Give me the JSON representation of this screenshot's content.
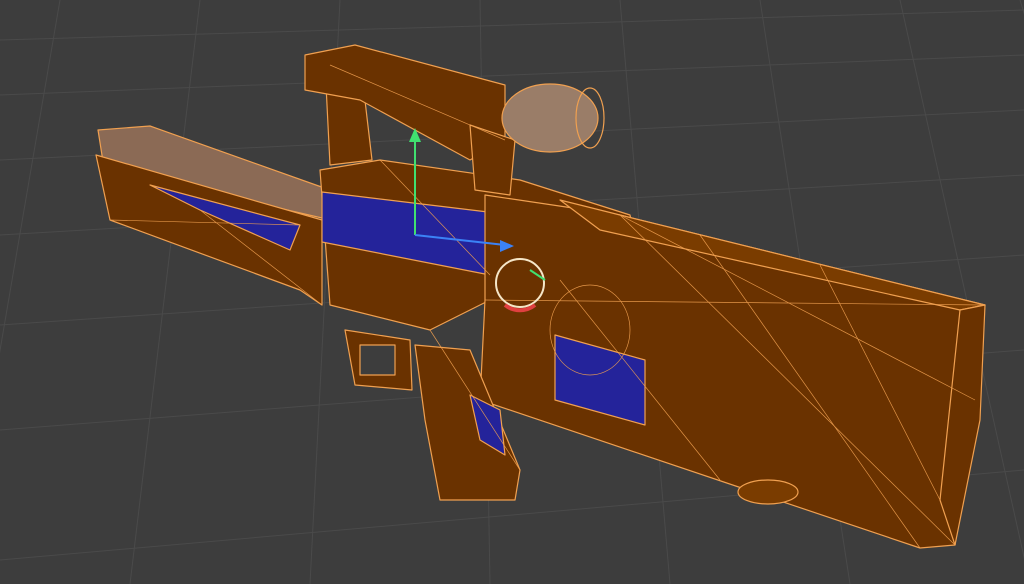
{
  "viewport": {
    "background_color": "#3d3d3d",
    "grid_color": "#4a4a4a",
    "wire_color": "#f0a050",
    "fill_color": "#6a3200",
    "highlight_face_color": "#24239a"
  },
  "scene": {
    "object": "rifle-mesh",
    "mode": "wireframe-overlay",
    "gizmo": {
      "x_axis_color": "#e04040",
      "y_axis_color": "#40e070",
      "z_axis_color": "#3b82f6"
    }
  }
}
